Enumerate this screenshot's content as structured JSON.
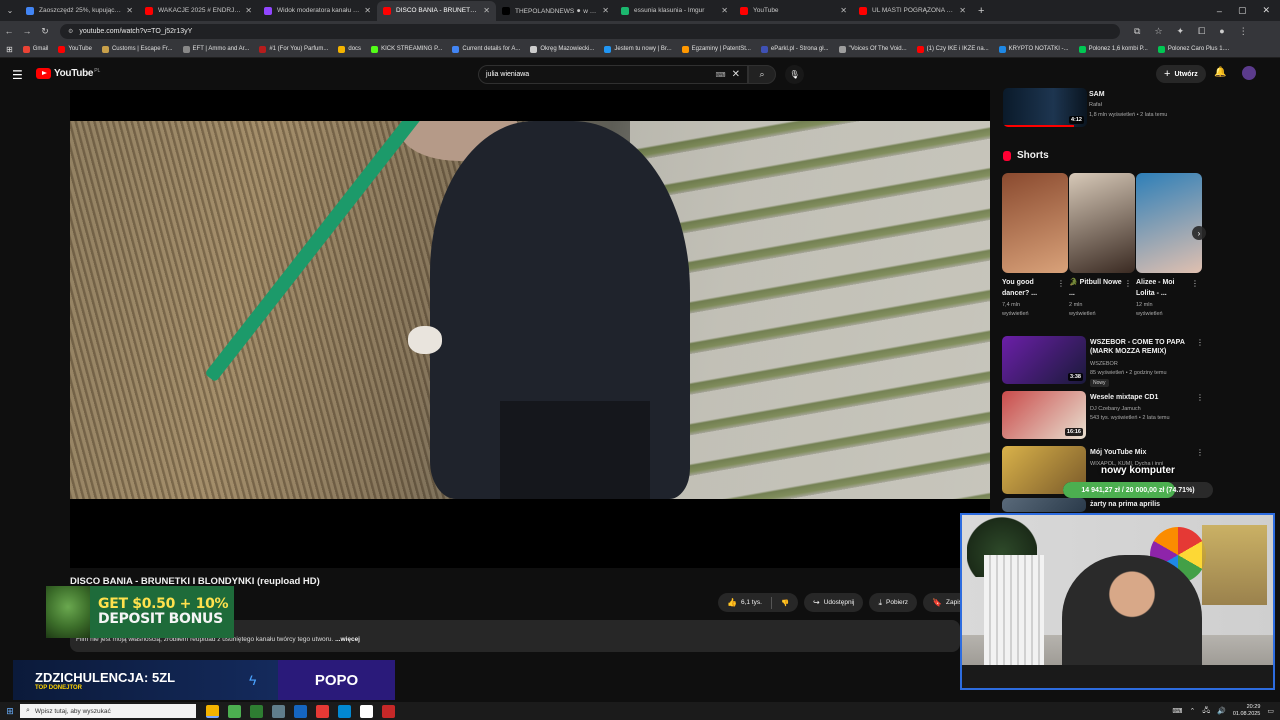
{
  "browser": {
    "tabs": [
      {
        "title": "Zaoszczędź 25%, kupując Bus I",
        "color": "#4285f4",
        "active": false
      },
      {
        "title": "WAKACJE 2025 # ENDRJU # EN",
        "color": "#ff0000",
        "active": false
      },
      {
        "title": "Widok moderatora kanału Mar",
        "color": "#9146ff",
        "active": false
      },
      {
        "title": "DISCO BANIA - BRUNETKI I B",
        "color": "#ff0000",
        "active": true
      },
      {
        "title": "THEPOLANDNEWS ⚫ w serwis",
        "color": "#000000",
        "active": false
      },
      {
        "title": "essunia klasunia - Imgur",
        "color": "#1bb76e",
        "active": false
      },
      {
        "title": "YouTube",
        "color": "#ff0000",
        "active": false
      },
      {
        "title": "UL MASTI POGRĄŻONA PRZEZ",
        "color": "#ff0000",
        "active": false
      }
    ],
    "url": "youtube.com/watch?v=TO_j52r13yY",
    "bookmarks": [
      {
        "label": "Gmail",
        "color": "#ea4335"
      },
      {
        "label": "YouTube",
        "color": "#ff0000"
      },
      {
        "label": "Customs | Escape Fr...",
        "color": "#c8a04a"
      },
      {
        "label": "EFT | Ammo and Ar...",
        "color": "#888888"
      },
      {
        "label": "#1 (For You) Parfum...",
        "color": "#b71c1c"
      },
      {
        "label": "docs",
        "color": "#f4b400"
      },
      {
        "label": "KICK STREAMING P...",
        "color": "#53fc18"
      },
      {
        "label": "Current details for A...",
        "color": "#4285f4"
      },
      {
        "label": "Okręg Mazowiecki...",
        "color": "#cccccc"
      },
      {
        "label": "Jestem tu nowy | Br...",
        "color": "#2196f3"
      },
      {
        "label": "Egzaminy | PatentSt...",
        "color": "#ff9800"
      },
      {
        "label": "eParkl.pl - Strona gł...",
        "color": "#3f51b5"
      },
      {
        "label": "\"Voices Of The Void...",
        "color": "#9e9e9e"
      },
      {
        "label": "(1) Czy IKE i IKZE na...",
        "color": "#ff0000"
      },
      {
        "label": "KRYPTO NOTATKI -...",
        "color": "#1e88e5"
      },
      {
        "label": "Polonez 1,6 kombi P...",
        "color": "#00c853"
      },
      {
        "label": "Polonez Caro Plus 1....",
        "color": "#00c853"
      }
    ]
  },
  "youtube": {
    "logo_text": "YouTube",
    "region": "PL",
    "search_query": "julia wieniawa",
    "create_label": "Utwórz",
    "video": {
      "title": "DISCO BANIA - BRUNETKI I BLONDYNKI (reupload HD)",
      "likes": "6,1 tys.",
      "share_label": "Udostępnij",
      "download_label": "Pobierz",
      "save_label": "Zapisz",
      "description_snippet": "Film nie jest moją własnością, zrobiłem reupload z usuniętego kanału twórcy tego utworu.",
      "more_label": "...więcej"
    },
    "sidebar": {
      "top_item": {
        "title": "SAM",
        "channel": "Rafał",
        "meta": "1,8 mln wyświetleń • 2 lata temu",
        "duration": "4:12",
        "watched": 0.85
      },
      "shorts_heading": "Shorts",
      "shorts": [
        {
          "title": "You good dancer? ...",
          "views": "7,4 mln",
          "views_label": "wyświetleń",
          "color_a": "#8a4a2f",
          "color_b": "#d9a27a"
        },
        {
          "title": "🐊 Pitbull Nowe ...",
          "views": "2 mln",
          "views_label": "wyświetleń",
          "color_a": "#d7c9b8",
          "color_b": "#3a2a22"
        },
        {
          "title": "Alizee - Moi Lolita - ...",
          "views": "12 mln",
          "views_label": "wyświetleń",
          "color_a": "#2e7fb8",
          "color_b": "#e0c0b0"
        }
      ],
      "items": [
        {
          "title_line1": "WSZEBOR - COME TO PAPA",
          "title_line2": "(MARK MOZZA REMIX)",
          "channel": "WSZEBOR",
          "meta": "85 wyświetleń • 2 godziny temu",
          "badge": "Nowy",
          "duration": "3:38",
          "color_a": "#6b1fa8",
          "color_b": "#1a1a3a"
        },
        {
          "title_line1": "Wesele mixtape CD1",
          "title_line2": "",
          "channel": "DJ Czebany Jamuch",
          "meta": "543 tys. wyświetleń • 2 lata temu",
          "badge": "",
          "duration": "16:16",
          "color_a": "#c94b4b",
          "color_b": "#e8e0d0"
        },
        {
          "title_line1": "Mój YouTube Mix",
          "title_line2": "",
          "channel": "WIXAPOL, KUMI, Dycha i inni",
          "meta": "",
          "badge": "",
          "duration": "",
          "color_a": "#d9b24a",
          "color_b": "#7a5a2a"
        },
        {
          "title_line1": "żarty na prima aprilis",
          "title_line2": "",
          "channel": "",
          "meta": "",
          "badge": "",
          "duration": "",
          "color_a": "#5a6a7a",
          "color_b": "#2a3a4a"
        }
      ]
    }
  },
  "overlay": {
    "promo_line1": "GET $0.50 + 10%",
    "promo_line2": "DEPOSIT BONUS",
    "donor_amount": "ZDZICHULENCJA: 5ZL",
    "donor_label": "TOP DONEJTOR",
    "popo_label": "POPO",
    "goal_title": "nowy komputer",
    "goal_text": "14 941,27 zł / 20 000,00 zł (74.71%)",
    "goal_fraction": 0.7471
  },
  "taskbar": {
    "search_placeholder": "Wpisz tutaj, aby wyszukać",
    "time": "20:29",
    "date": "01.08.2025",
    "apps": [
      "#f4b400",
      "#4caf50",
      "#2e7d32",
      "#607d8b",
      "#1565c0",
      "#e53935",
      "#0288d1",
      "#ffffff",
      "#c62828"
    ]
  }
}
